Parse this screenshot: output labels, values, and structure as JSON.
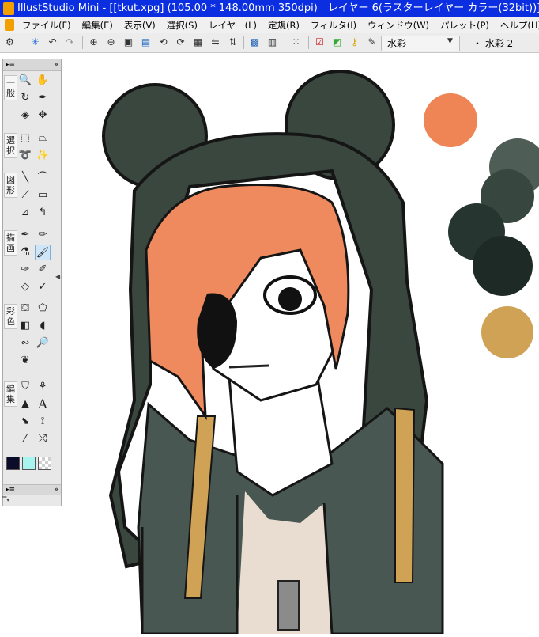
{
  "window": {
    "title": "IllustStudio Mini - [[tkut.xpg] (105.00 * 148.00mm 350dpi)　レイヤー 6(ラスターレイヤー カラー(32bit))]"
  },
  "menu": {
    "items": [
      "ファイル(F)",
      "編集(E)",
      "表示(V)",
      "選択(S)",
      "レイヤー(L)",
      "定規(R)",
      "フィルタ(I)",
      "ウィンドウ(W)",
      "パレット(P)",
      "ヘルプ(H)"
    ]
  },
  "toolbar": {
    "brush_name": "水彩",
    "dropdown_glyph": "▼",
    "brush_size_label": "・ 水彩 2"
  },
  "tool_palette": {
    "header_left": "▸≡",
    "header_right": "»",
    "footer_left": "▸≡",
    "footer_right": "»",
    "categories": [
      "一般",
      "選択",
      "図形",
      "描画",
      "彩色",
      "編集"
    ],
    "text_tool_glyph": "A",
    "main_color": "#0b0b2a",
    "sub_color": "#a8f5ef"
  },
  "artwork": {
    "palette_colors": [
      "#ef8455",
      "#4e5e57",
      "#37463f",
      "#263530",
      "#1e2a26",
      "#cfa256"
    ],
    "hat_color": "#39473f",
    "hair_color": "#ef8a5e",
    "jacket_color": "#495752",
    "strap_color": "#cfa256",
    "shirt_color": "#e8ddd0"
  }
}
